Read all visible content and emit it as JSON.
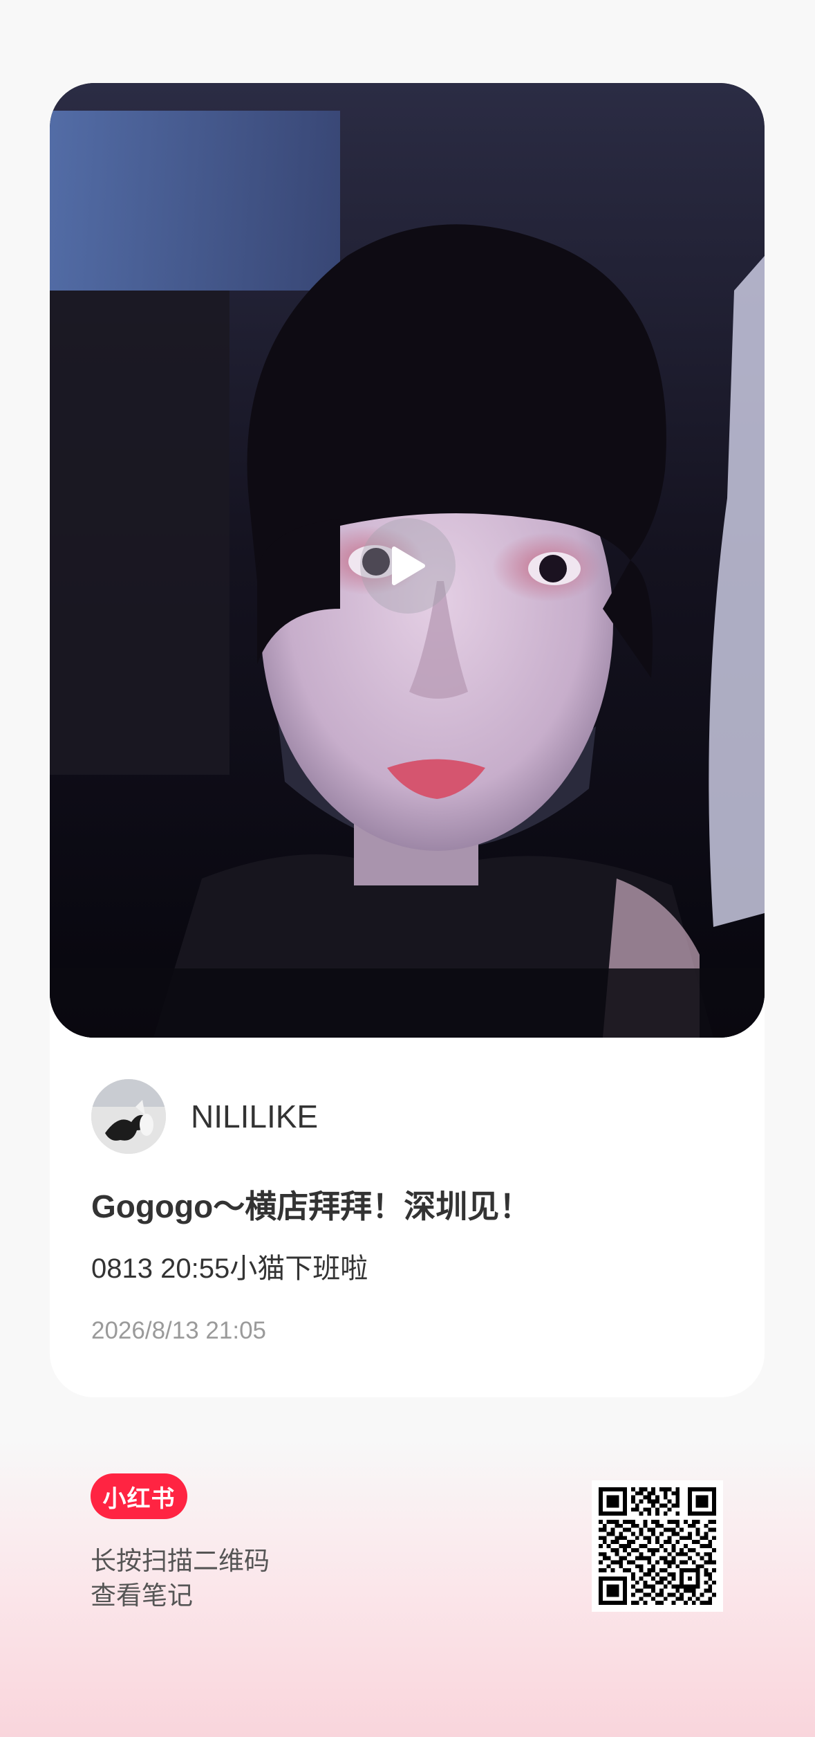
{
  "author": {
    "name": "NILILIKE"
  },
  "note": {
    "title": "Gogogo～横店拜拜！深圳见！",
    "description": "0813 20:55小猫下班啦",
    "date": "2026/8/13 21:05"
  },
  "media": {
    "type": "video",
    "play_icon": "play-icon"
  },
  "footer": {
    "brand": "小红书",
    "scan_line_1": "长按扫描二维码",
    "scan_line_2": "查看笔记"
  },
  "colors": {
    "brand_red": "#ff2442",
    "text_primary": "#333333",
    "text_secondary": "#9a9a9a"
  }
}
